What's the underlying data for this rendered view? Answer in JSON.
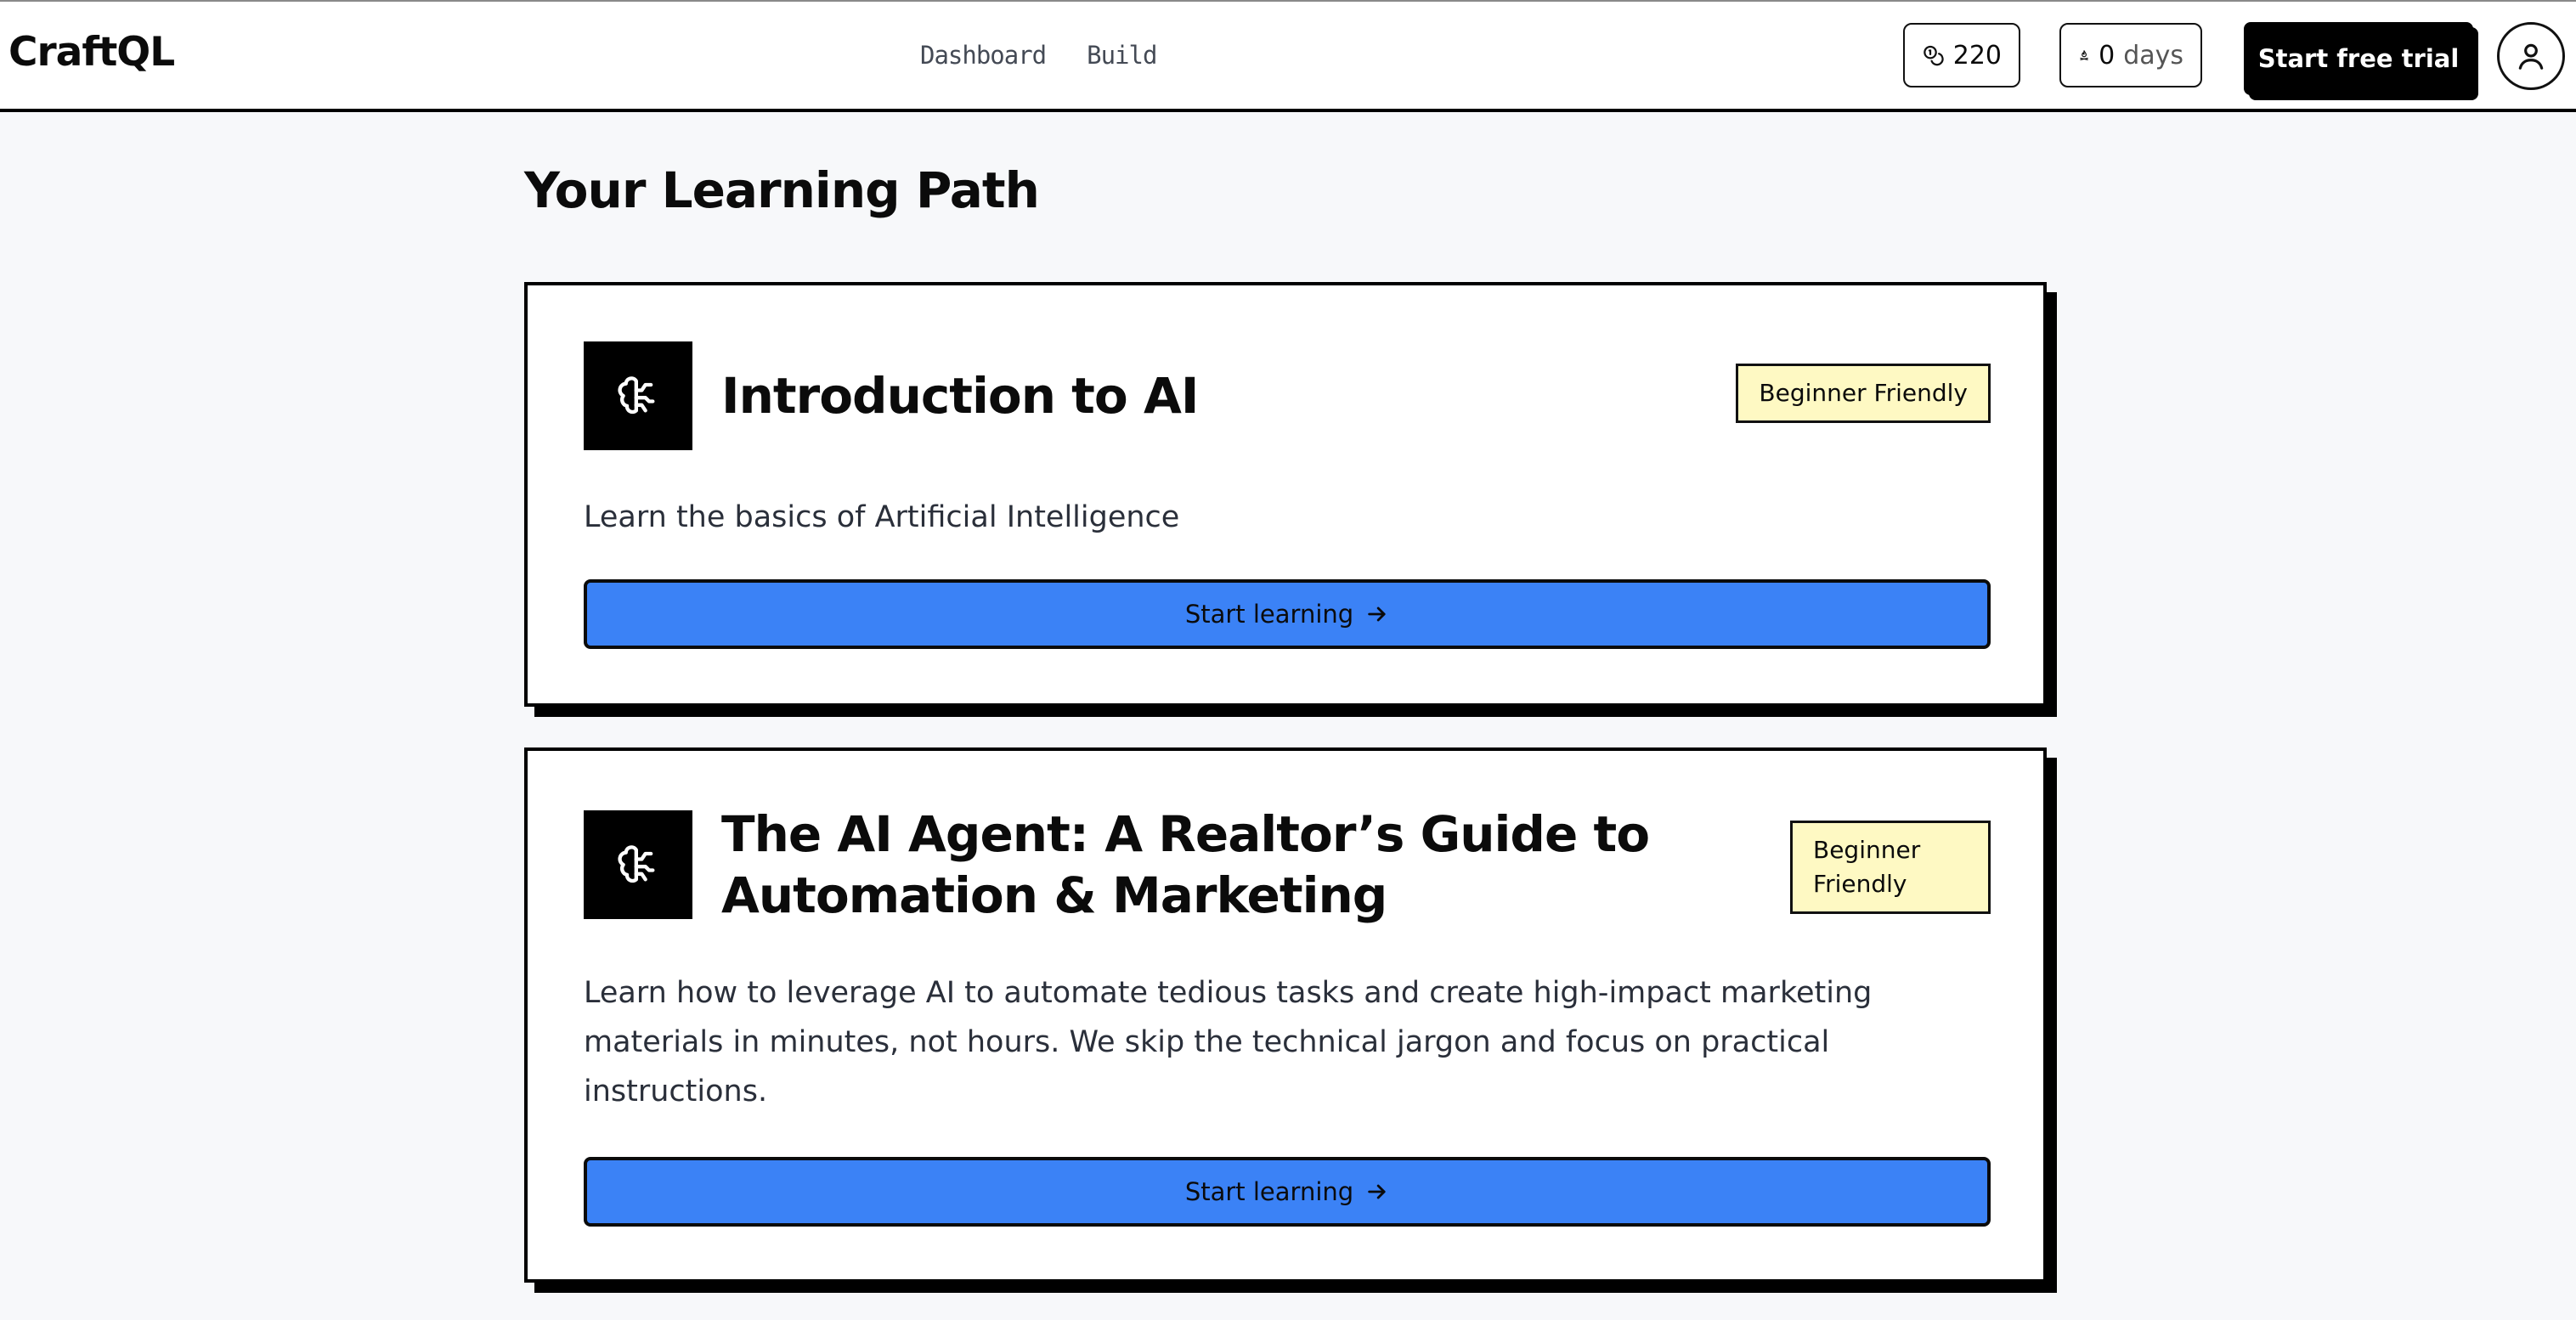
{
  "header": {
    "logo": "CraftQL",
    "nav": [
      {
        "label": "Dashboard"
      },
      {
        "label": "Build"
      }
    ],
    "points": "220",
    "streak_value": "0",
    "streak_unit": "days",
    "trial_button": "Start free trial",
    "icons": {
      "points": "coins-icon",
      "streak": "flame-icon",
      "avatar": "user-icon"
    }
  },
  "main": {
    "title": "Your Learning Path",
    "courses": [
      {
        "title": "Introduction to AI",
        "badge": "Beginner Friendly",
        "description": "Learn the basics of Artificial Intelligence",
        "button": "Start learning",
        "icon": "brain-icon"
      },
      {
        "title": "The AI Agent: A Realtor’s Guide to Automation & Marketing",
        "badge": "Beginner Friendly",
        "description": "Learn how to leverage AI to automate tedious tasks and create high-impact marketing materials in minutes, not hours. We skip the technical jargon and focus on practical instructions.",
        "button": "Start learning",
        "icon": "brain-icon"
      }
    ]
  },
  "colors": {
    "accent": "#3b82f6",
    "badge_bg": "#fef9c3",
    "background": "#f7f8fa"
  }
}
